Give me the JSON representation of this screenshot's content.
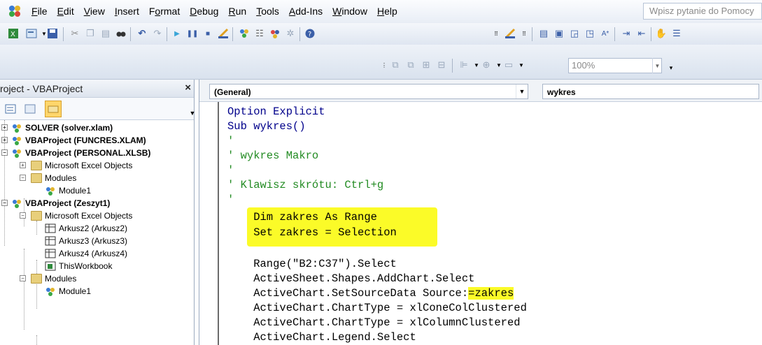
{
  "menubar": {
    "items": [
      {
        "label": "File",
        "accel": "F"
      },
      {
        "label": "Edit",
        "accel": "E"
      },
      {
        "label": "View",
        "accel": "V"
      },
      {
        "label": "Insert",
        "accel": "I"
      },
      {
        "label": "Format",
        "accel": "o"
      },
      {
        "label": "Debug",
        "accel": "D"
      },
      {
        "label": "Run",
        "accel": "R"
      },
      {
        "label": "Tools",
        "accel": "T"
      },
      {
        "label": "Add-Ins",
        "accel": "A"
      },
      {
        "label": "Window",
        "accel": "W"
      },
      {
        "label": "Help",
        "accel": "H"
      }
    ],
    "help_search": "Wpisz pytanie do Pomocy"
  },
  "toolbar": {
    "zoom": "100%"
  },
  "project": {
    "title": "roject - VBAProject",
    "close": "×",
    "tree": [
      {
        "label": "SOLVER (solver.xlam)",
        "bold": true
      },
      {
        "label": "VBAProject (FUNCRES.XLAM)",
        "bold": true
      },
      {
        "label": "VBAProject (PERSONAL.XLSB)",
        "bold": true
      },
      {
        "label": "Microsoft Excel Objects",
        "bold": false
      },
      {
        "label": "Modules",
        "bold": false
      },
      {
        "label": "Module1",
        "bold": false
      },
      {
        "label": "VBAProject (Zeszyt1)",
        "bold": true
      },
      {
        "label": "Microsoft Excel Objects",
        "bold": false
      },
      {
        "label": "Arkusz2 (Arkusz2)",
        "bold": false
      },
      {
        "label": "Arkusz3 (Arkusz3)",
        "bold": false
      },
      {
        "label": "Arkusz4 (Arkusz4)",
        "bold": false
      },
      {
        "label": "ThisWorkbook",
        "bold": false
      },
      {
        "label": "Modules",
        "bold": false
      },
      {
        "label": "Module1",
        "bold": false
      }
    ]
  },
  "code": {
    "object_combo": "(General)",
    "proc_combo": "wykres",
    "lines": [
      "Option Explicit",
      "Sub wykres()",
      "'",
      "' wykres Makro",
      "'",
      "' Klawisz skrótu: Ctrl+g",
      "'",
      "    Dim zakres As Range",
      "    Set zakres = Selection",
      "",
      "    Range(\"B2:C37\").Select",
      "    ActiveSheet.Shapes.AddChart.Select",
      "    ActiveChart.SetSourceData Source:",
      "    ActiveChart.ChartType = xlConeColClustered",
      "    ActiveChart.ChartType = xlColumnClustered",
      "    ActiveChart.Legend.Select"
    ],
    "highlight_tail": "=zakres"
  },
  "colors": {
    "keyword": "#00008b",
    "comment": "#228b22",
    "highlight": "#fbfb28"
  }
}
